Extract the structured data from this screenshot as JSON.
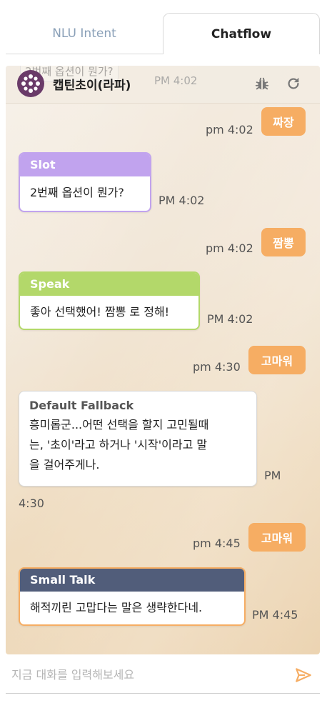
{
  "tabs": {
    "nlu": "NLU Intent",
    "chatflow": "Chatflow"
  },
  "header": {
    "bot_name": "캡틴초이(라파)",
    "ghost_message": "2번째 옵션이 뭔가?",
    "ghost_time": "PM 4:02"
  },
  "messages": {
    "u1": {
      "text": "짜장",
      "time": "pm 4:02"
    },
    "b1": {
      "label": "Slot",
      "text": "2번째 옵션이 뭔가?",
      "time": "PM 4:02",
      "color": "#c1a3ee"
    },
    "u2": {
      "text": "짬뽕",
      "time": "pm 4:02"
    },
    "b2": {
      "label": "Speak",
      "text": "좋아 선택했어! 짬뽕 로 정해!",
      "time": "PM 4:02",
      "color": "#b3d86a"
    },
    "u3": {
      "text": "고마워",
      "time": "pm 4:30"
    },
    "b3": {
      "label": "Default Fallback",
      "line1": "흥미롭군...어떤 선택을 할지 고민될때",
      "line2": "는, '초이'라고 하거나 '시작'이라고 말",
      "line3": "을 걸어주게나.",
      "time_a": "PM",
      "time_b": "4:30"
    },
    "u4": {
      "text": "고마워",
      "time": "pm 4:45"
    },
    "b4": {
      "label": "Small Talk",
      "text": "해적끼린 고맙다는 말은 생략한다네.",
      "time": "PM 4:45",
      "color": "#515d7a"
    }
  },
  "input": {
    "placeholder": "지금 대화를 입력해보세요"
  },
  "colors": {
    "user_bubble": "#f6ad63",
    "accent": "#f6ad63"
  },
  "icons": {
    "bug": "bug-icon",
    "refresh": "refresh-icon",
    "send": "send-icon"
  }
}
